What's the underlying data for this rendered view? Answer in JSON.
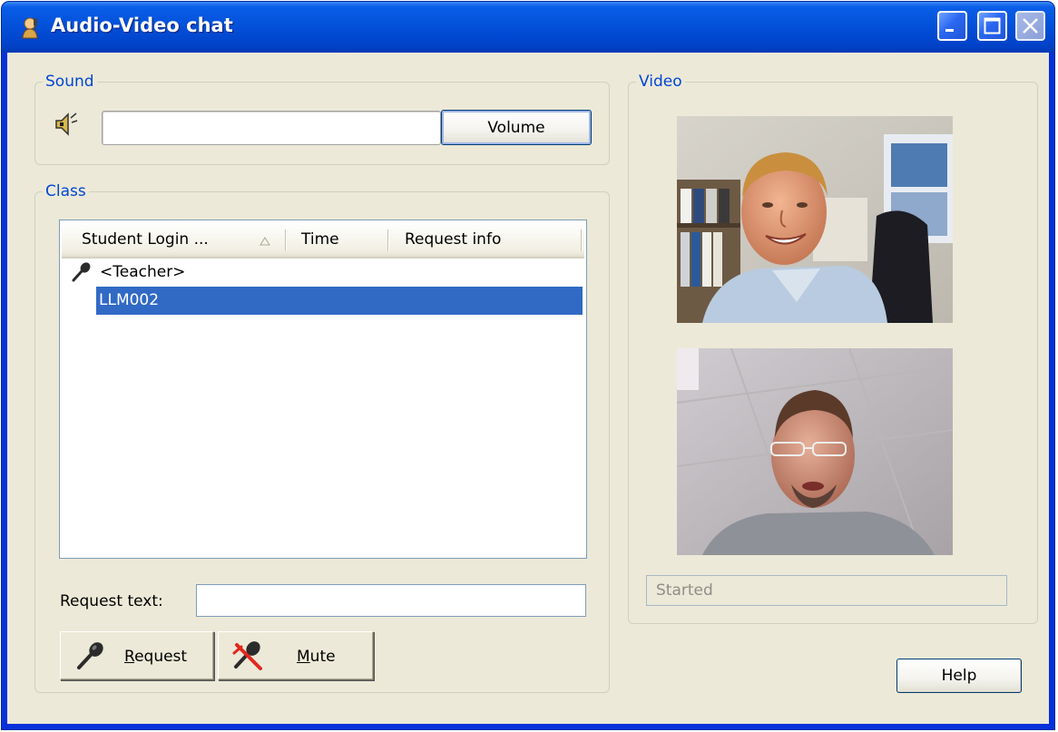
{
  "window": {
    "title": "Audio-Video chat"
  },
  "sound": {
    "group_label": "Sound",
    "icon": "speaker-icon",
    "volume_value": "",
    "volume_button_label": "Volume"
  },
  "class": {
    "group_label": "Class",
    "columns": [
      "Student Login ...",
      "Time",
      "Request info"
    ],
    "sort_indicator": "▲",
    "rows": [
      {
        "login": "<Teacher>",
        "time": "",
        "request_info": "",
        "icon": "microphone-icon",
        "selected": false
      },
      {
        "login": "LLM002",
        "time": "",
        "request_info": "",
        "icon": "",
        "selected": true
      }
    ],
    "request_text_label": "Request text:",
    "request_text_value": "",
    "request_button": {
      "prefix": "",
      "mnemonic": "R",
      "rest": "equest"
    },
    "mute_button": {
      "prefix": "",
      "mnemonic": "M",
      "rest": "ute"
    }
  },
  "video": {
    "group_label": "Video",
    "status": "Started"
  },
  "footer": {
    "help_label": "Help"
  },
  "colors": {
    "title_bar": "#0453dc",
    "client_bg": "#ece9d8",
    "group_label": "#0046d5",
    "selection": "#316ac5",
    "mute_cross": "#e0281e"
  }
}
